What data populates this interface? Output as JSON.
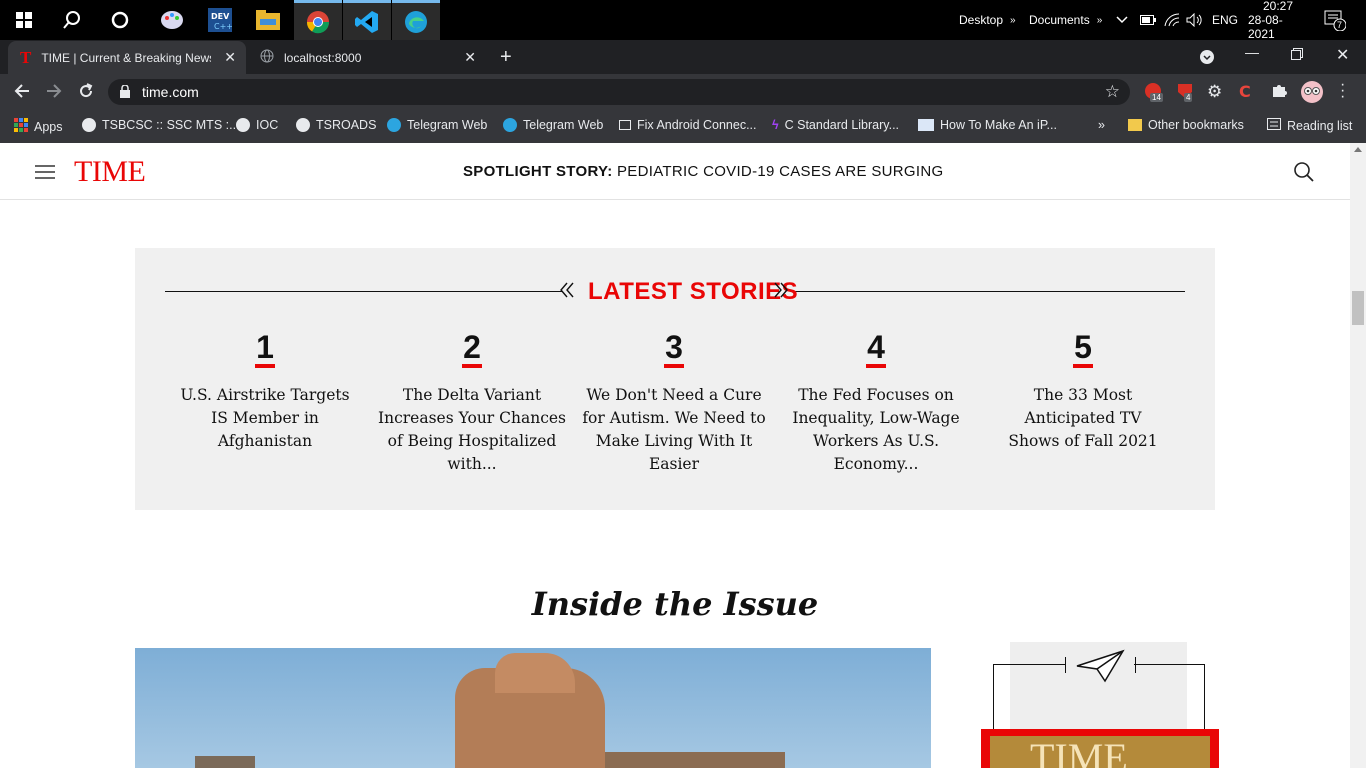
{
  "taskbar": {
    "right_items": [
      "Desktop",
      "Documents"
    ],
    "lang": "ENG",
    "time": "20:27",
    "date": "28-08-2021",
    "notifications": "7"
  },
  "tabs": [
    {
      "label": "TIME | Current & Breaking News",
      "active": true
    },
    {
      "label": "localhost:8000",
      "active": false
    }
  ],
  "address": {
    "url": "time.com"
  },
  "bookmarks": {
    "items": [
      "Apps",
      "TSBCSC :: SSC MTS :...",
      "IOC",
      "TSROADS",
      "Telegram Web",
      "Telegram Web",
      "Fix Android Connec...",
      "C Standard Library...",
      "How To Make An iP..."
    ],
    "other": "Other bookmarks",
    "reading_list": "Reading list"
  },
  "extension_badges": [
    "14",
    "4"
  ],
  "site": {
    "logo": "TIME",
    "spotlight_label": "SPOTLIGHT STORY:",
    "spotlight_text": " PEDIATRIC COVID-19 CASES ARE SURGING"
  },
  "latest": {
    "title": "LATEST STORIES",
    "stories": [
      {
        "num": "1",
        "headline": "U.S. Airstrike Targets IS Member in Afghanistan"
      },
      {
        "num": "2",
        "headline": "The Delta Variant Increases Your Chances of Being Hospitalized with..."
      },
      {
        "num": "3",
        "headline": "We Don't Need a Cure for Autism. We Need to Make Living With It Easier"
      },
      {
        "num": "4",
        "headline": "The Fed Focuses on Inequality, Low-Wage Workers As U.S. Economy..."
      },
      {
        "num": "5",
        "headline": "The 33 Most Anticipated TV Shows of Fall 2021"
      }
    ]
  },
  "inside": {
    "title": "Inside the Issue",
    "cover_text": "TIME"
  },
  "colors": {
    "brand_red": "#e90606",
    "panel": "#f0f0f0",
    "chrome_dark": "#202124"
  }
}
